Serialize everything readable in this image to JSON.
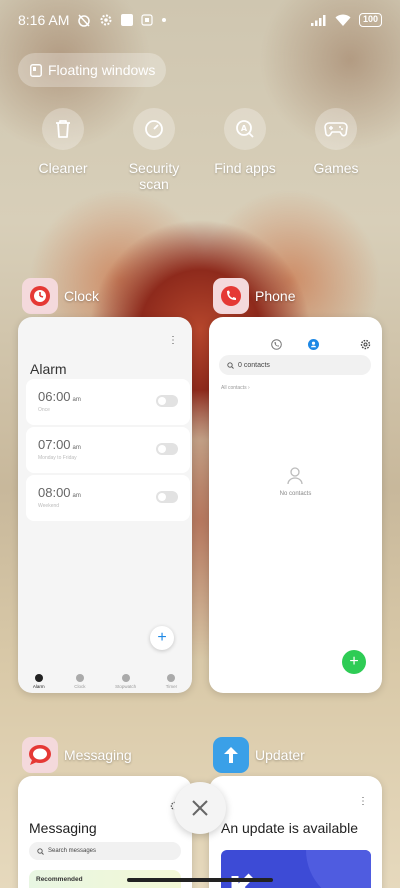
{
  "status_bar": {
    "time": "8:16 AM",
    "battery": "100",
    "icons": [
      "alarm-off-icon",
      "settings-icon",
      "square-icon",
      "memory-icon",
      "dot-icon",
      "signal-icon",
      "wifi-icon"
    ]
  },
  "floating_windows": {
    "label": "Floating windows"
  },
  "quick_actions": [
    {
      "label": "Cleaner",
      "icon": "trash-icon"
    },
    {
      "label": "Security scan",
      "icon": "security-scan-icon"
    },
    {
      "label": "Find apps",
      "icon": "find-apps-icon"
    },
    {
      "label": "Games",
      "icon": "gamepad-icon"
    }
  ],
  "apps": {
    "clock": {
      "name": "Clock",
      "screen_title": "Alarm",
      "alarms": [
        {
          "time": "06:00",
          "ampm": "am",
          "sub": "Once"
        },
        {
          "time": "07:00",
          "ampm": "am",
          "sub": "Monday to Friday"
        },
        {
          "time": "08:00",
          "ampm": "am",
          "sub": "Weekend"
        }
      ],
      "tabs": [
        "Alarm",
        "Clock",
        "Stopwatch",
        "Timer"
      ],
      "fab_label": "+"
    },
    "phone": {
      "name": "Phone",
      "search_text": "0 contacts",
      "all_contacts": "All contacts",
      "empty_text": "No contacts",
      "fab_label": "+"
    },
    "messaging": {
      "name": "Messaging",
      "screen_title": "Messaging",
      "search_placeholder": "Search messages",
      "banner_title": "Recommended"
    },
    "updater": {
      "name": "Updater",
      "screen_title": "An update is available"
    }
  },
  "colors": {
    "accent_blue": "#1e88e5",
    "fab_green": "#2ecc55",
    "updater_banner": "#3d4bd6"
  }
}
